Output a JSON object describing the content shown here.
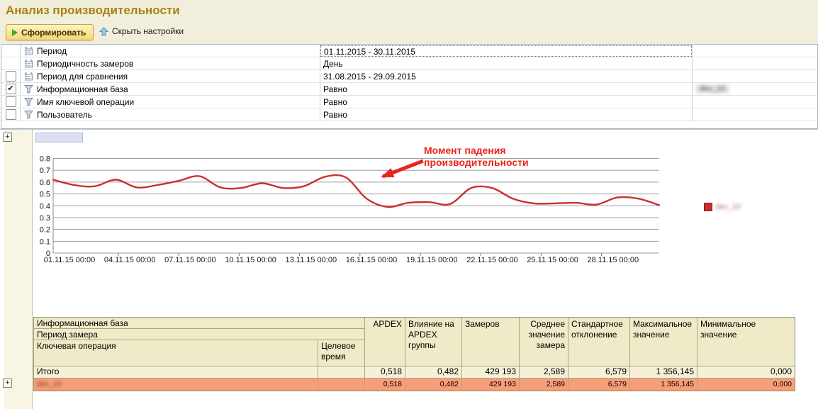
{
  "window": {
    "title": "Анализ производительности"
  },
  "toolbar": {
    "generate_label": "Сформировать",
    "hide_settings_label": "Скрыть настройки"
  },
  "settings": {
    "rows": [
      {
        "icon": "period-calendar-icon",
        "checkbox": null,
        "label": "Период",
        "value": "01.11.2015 - 30.11.2015",
        "focused": true
      },
      {
        "icon": "period-calendar-icon",
        "checkbox": null,
        "label": "Периодичность замеров",
        "value": "День"
      },
      {
        "icon": "period-calendar-icon",
        "checkbox": false,
        "label": "Период для сравнения",
        "value": "31.08.2015 - 29.09.2015"
      },
      {
        "icon": "filter-icon",
        "checkbox": true,
        "label": "Информационная база",
        "value": "Равно",
        "extra_masked": "dev_10"
      },
      {
        "icon": "filter-icon",
        "checkbox": false,
        "label": "Имя ключевой операции",
        "value": "Равно"
      },
      {
        "icon": "filter-icon",
        "checkbox": false,
        "label": "Пользователь",
        "value": "Равно"
      }
    ]
  },
  "chart_data": {
    "type": "line",
    "title": "",
    "xlabel": "",
    "ylabel": "",
    "ylim": [
      0,
      0.8
    ],
    "grid": true,
    "legend_position": "right",
    "y_ticks": [
      "0.8",
      "0.7",
      "0.6",
      "0.5",
      "0.4",
      "0.3",
      "0.2",
      "0.1",
      "0"
    ],
    "x_labels": [
      "01.11.15 00:00",
      "04.11.15 00:00",
      "07.11.15 00:00",
      "10.11.15 00:00",
      "13.11.15 00:00",
      "16.11.15 00:00",
      "19.11.15 00:00",
      "22.11.15 00:00",
      "25.11.15 00:00",
      "28.11.15 00:00"
    ],
    "x_days": [
      1,
      2,
      3,
      4,
      5,
      6,
      7,
      8,
      9,
      10,
      11,
      12,
      13,
      14,
      15,
      16,
      17,
      18,
      19,
      20,
      21,
      22,
      23,
      24,
      25,
      26,
      27,
      28,
      29,
      30
    ],
    "series": [
      {
        "name": "dev_10",
        "masked": true,
        "color": "#c8302b",
        "values": [
          0.62,
          0.575,
          0.565,
          0.62,
          0.555,
          0.575,
          0.61,
          0.65,
          0.555,
          0.55,
          0.59,
          0.55,
          0.565,
          0.645,
          0.64,
          0.46,
          0.39,
          0.425,
          0.43,
          0.415,
          0.55,
          0.55,
          0.46,
          0.42,
          0.42,
          0.425,
          0.41,
          0.47,
          0.46,
          0.405
        ]
      }
    ],
    "annotation": {
      "line1": "Момент падения",
      "line2": "производительности",
      "color": "#e8251c",
      "points_to_day": 15.6
    }
  },
  "results_table": {
    "header": {
      "row1": "Информационная база",
      "row2": "Период замера",
      "row3": "Ключевая операция",
      "target_time": "Целевое время",
      "metrics": [
        "APDEX",
        "Влияние на APDEX группы",
        "Замеров",
        "Среднее значение замера",
        "Стандартное отклонение",
        "Максимальное значение",
        "Минимальное значение"
      ]
    },
    "rows": [
      {
        "name": "Итого",
        "masked": false,
        "values": [
          "0,518",
          "0,482",
          "429 193",
          "2,589",
          "6,579",
          "1 356,145",
          "0,000"
        ]
      },
      {
        "name": "dev_10",
        "masked": true,
        "values": [
          "0,518",
          "0,482",
          "429 193",
          "2,589",
          "6,579",
          "1 356,145",
          "0,000"
        ]
      }
    ]
  },
  "colors": {
    "accent_line": "#c8302b",
    "annotation_red": "#e8251c",
    "header_beige": "#f1eedc",
    "table_header": "#efeac8",
    "highlight_row": "#f79e79",
    "title_gold": "#a8820b"
  }
}
